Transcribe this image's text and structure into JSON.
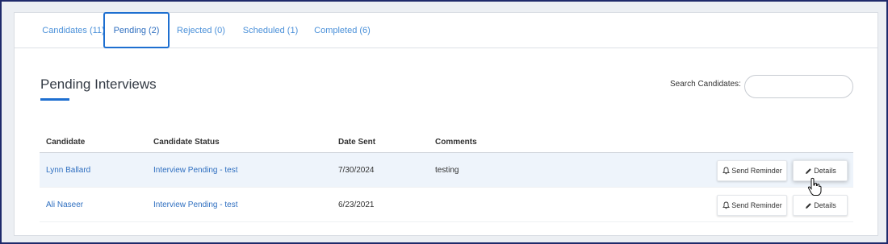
{
  "tabs": [
    {
      "label": "Candidates (11)"
    },
    {
      "label": "Pending (2)"
    },
    {
      "label": "Rejected (0)"
    },
    {
      "label": "Scheduled (1)"
    },
    {
      "label": "Completed (6)"
    }
  ],
  "active_tab": "Pending (2)",
  "page_title": "Pending Interviews",
  "search": {
    "label": "Search Candidates:",
    "value": "",
    "placeholder": ""
  },
  "table": {
    "headers": [
      "Candidate",
      "Candidate Status",
      "Date Sent",
      "Comments"
    ],
    "rows": [
      {
        "candidate": "Lynn Ballard",
        "status": "Interview Pending - test",
        "date_sent": "7/30/2024",
        "comments": "testing"
      },
      {
        "candidate": "Ali Naseer",
        "status": "Interview Pending - test",
        "date_sent": "6/23/2021",
        "comments": ""
      }
    ]
  },
  "actions": {
    "send_reminder": "Send Reminder",
    "details": "Details"
  },
  "icons": {
    "reminder": "bell-icon",
    "details": "pencil-icon",
    "cursor": "hand-pointer-icon"
  },
  "colors": {
    "accent": "#1e6fd0",
    "link": "#2f6fc0",
    "frame": "#1f2a6b",
    "row_highlight": "#eef4fb"
  }
}
